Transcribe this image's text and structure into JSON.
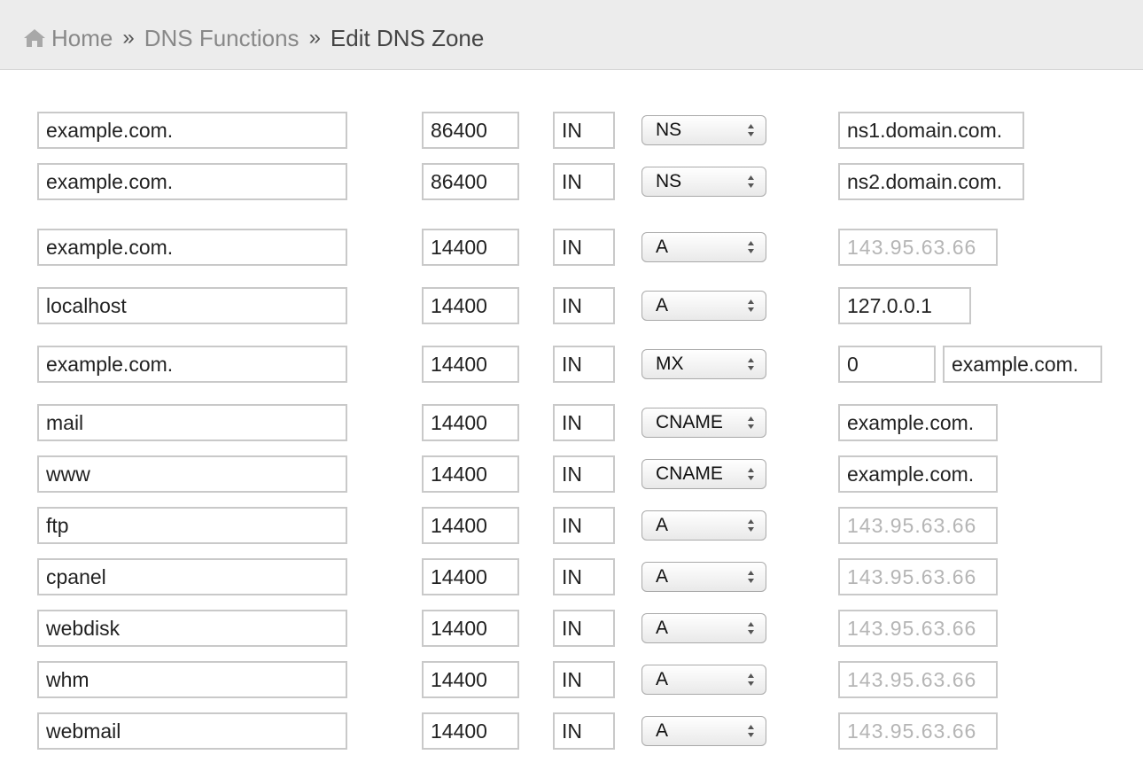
{
  "breadcrumb": {
    "home": "Home",
    "separator": "»",
    "section": "DNS Functions",
    "current": "Edit DNS Zone"
  },
  "records": [
    {
      "name": "example.com.",
      "ttl": "86400",
      "class": "IN",
      "type": "NS",
      "value": "ns1.domain.com."
    },
    {
      "name": "example.com.",
      "ttl": "86400",
      "class": "IN",
      "type": "NS",
      "value": "ns2.domain.com."
    },
    {
      "name": "example.com.",
      "ttl": "14400",
      "class": "IN",
      "type": "A",
      "value": "143.95.63.66",
      "obscured": true
    },
    {
      "name": "localhost",
      "ttl": "14400",
      "class": "IN",
      "type": "A",
      "value": "127.0.0.1"
    },
    {
      "name": "example.com.",
      "ttl": "14400",
      "class": "IN",
      "type": "MX",
      "priority": "0",
      "value": "example.com."
    },
    {
      "name": "mail",
      "ttl": "14400",
      "class": "IN",
      "type": "CNAME",
      "value": "example.com."
    },
    {
      "name": "www",
      "ttl": "14400",
      "class": "IN",
      "type": "CNAME",
      "value": "example.com."
    },
    {
      "name": "ftp",
      "ttl": "14400",
      "class": "IN",
      "type": "A",
      "value": "143.95.63.66",
      "obscured": true
    },
    {
      "name": "cpanel",
      "ttl": "14400",
      "class": "IN",
      "type": "A",
      "value": "143.95.63.66",
      "obscured": true
    },
    {
      "name": "webdisk",
      "ttl": "14400",
      "class": "IN",
      "type": "A",
      "value": "143.95.63.66",
      "obscured": true
    },
    {
      "name": "whm",
      "ttl": "14400",
      "class": "IN",
      "type": "A",
      "value": "143.95.63.66",
      "obscured": true
    },
    {
      "name": "webmail",
      "ttl": "14400",
      "class": "IN",
      "type": "A",
      "value": "143.95.63.66",
      "obscured": true
    }
  ]
}
